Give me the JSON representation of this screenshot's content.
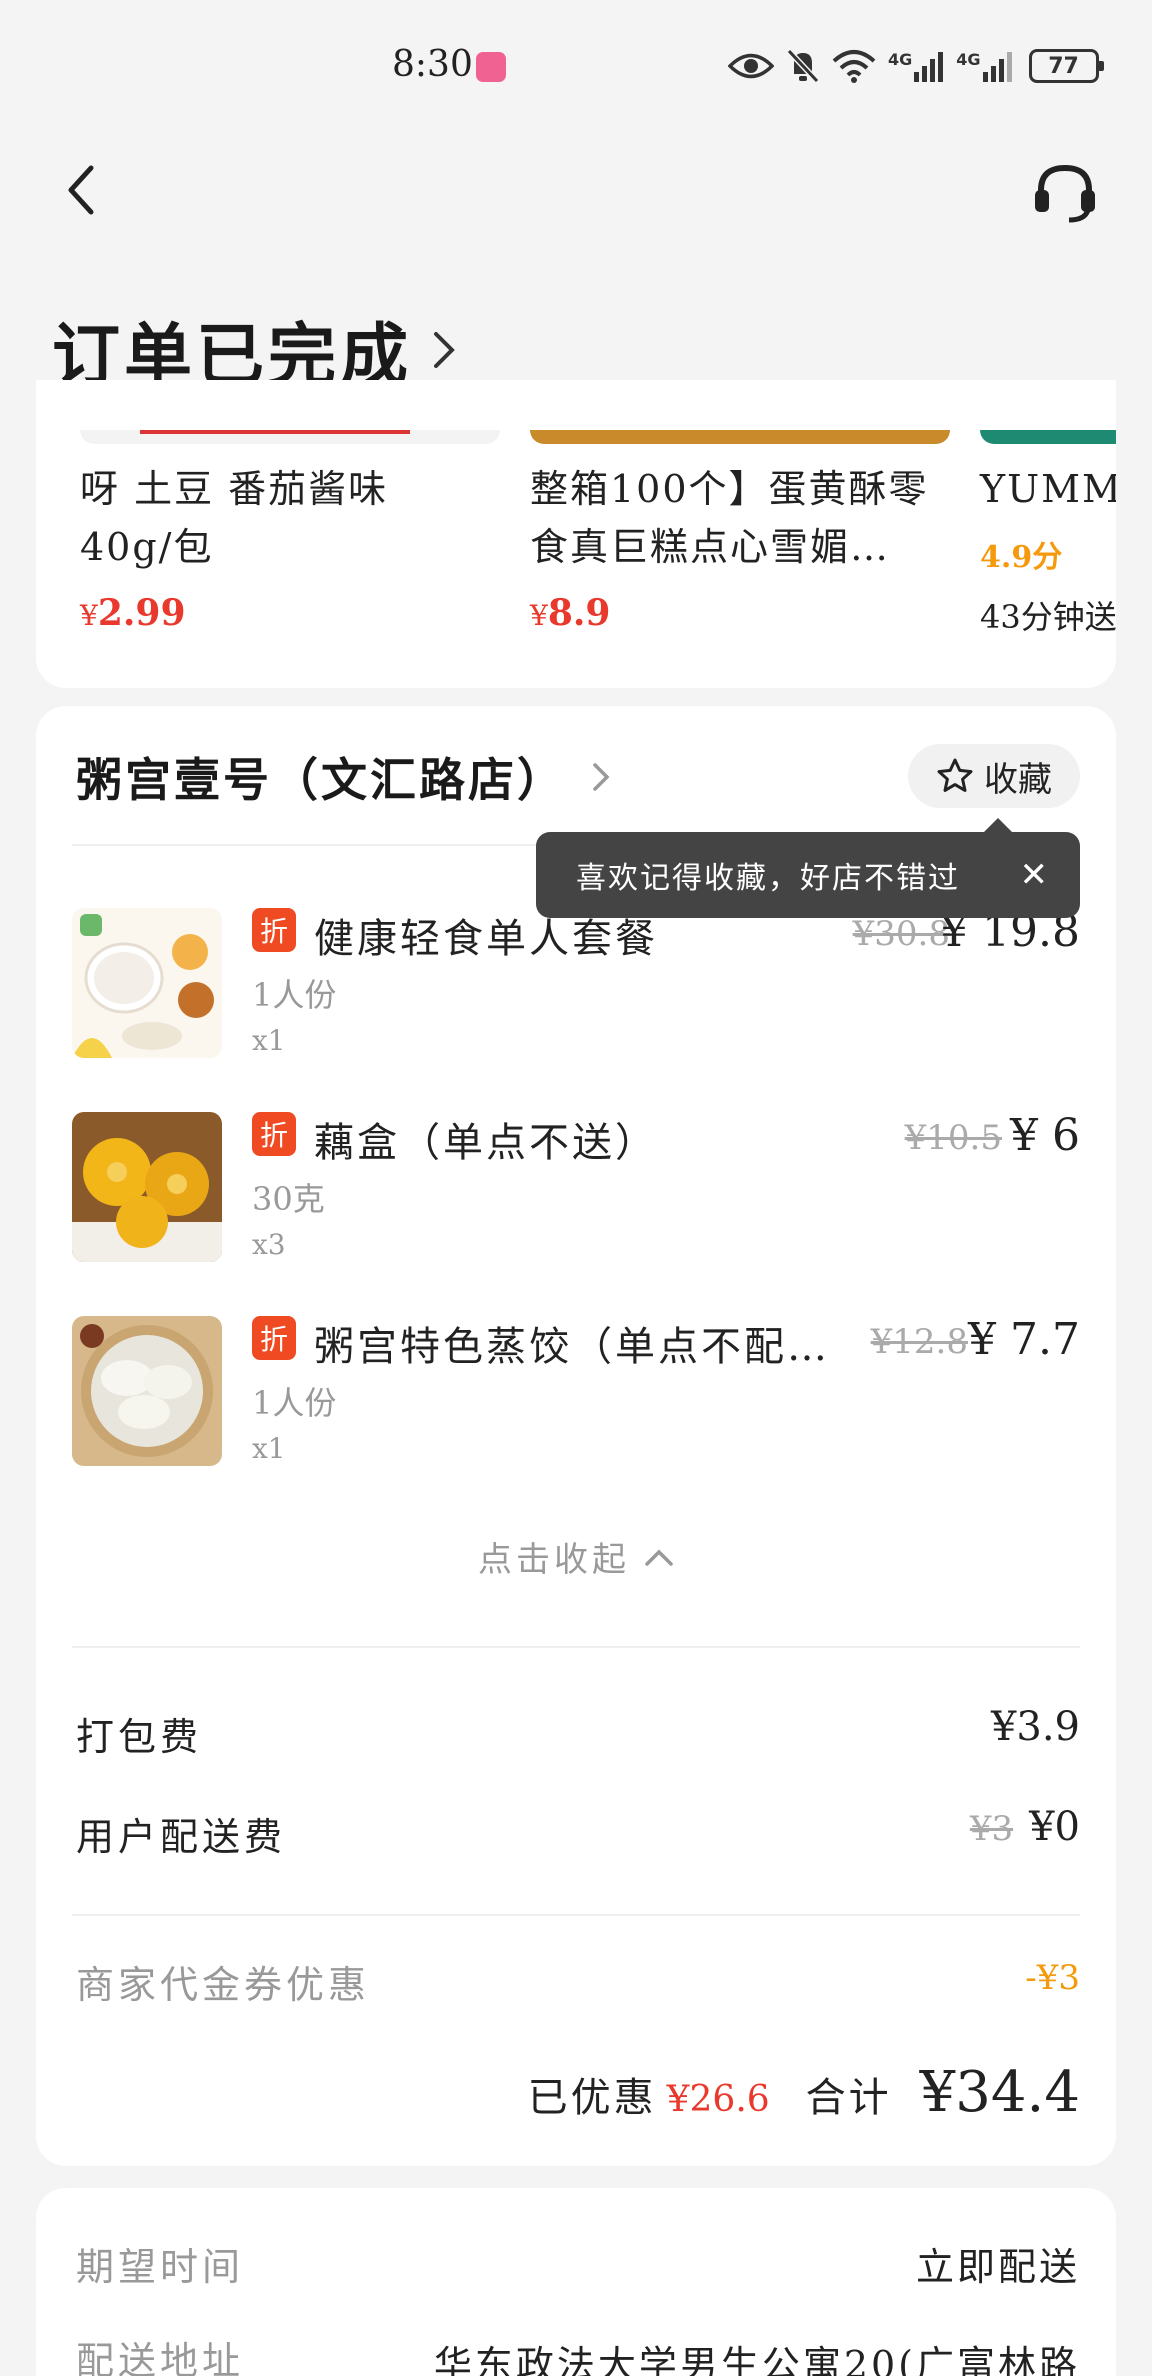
{
  "status_bar": {
    "time": "8:30",
    "battery": "77",
    "signal_1": "4G",
    "signal_2": "4G"
  },
  "header": {
    "title": "订单已完成"
  },
  "recommendations": [
    {
      "name_line1": "呀 土豆 番茄酱味",
      "name_line2": "40g/包",
      "currency": "¥",
      "price": "2.99"
    },
    {
      "name_line1": "整箱100个】蛋黄酥零",
      "name_line2": "食真巨糕点心雪媚…",
      "currency": "¥",
      "price": "8.9"
    },
    {
      "name_line1": "YUMMY韩",
      "rating": "4.9分",
      "delivery": "43分钟送"
    }
  ],
  "store": {
    "name": "粥宫壹号（文汇路店）",
    "favorite_label": "收藏",
    "tooltip": "喜欢记得收藏，好店不错过",
    "tooltip_close": "✕"
  },
  "items": [
    {
      "tag": "折",
      "name": "健康轻食单人套餐",
      "spec": "1人份",
      "qty": "x1",
      "original_price": "¥30.8",
      "price": "¥ 19.8"
    },
    {
      "tag": "折",
      "name": "藕盒（单点不送）",
      "spec": "30克",
      "qty": "x3",
      "original_price": "¥10.5",
      "price": "¥ 6"
    },
    {
      "tag": "折",
      "name": "粥宫特色蒸饺（单点不配…",
      "spec": "1人份",
      "qty": "x1",
      "original_price": "¥12.8",
      "price": "¥ 7.7"
    }
  ],
  "collapse_label": "点击收起",
  "fees": {
    "packing_label": "打包费",
    "packing_value": "¥3.9",
    "delivery_label": "用户配送费",
    "delivery_original": "¥3",
    "delivery_value": "¥0",
    "coupon_label": "商家代金券优惠",
    "coupon_value": "-¥3"
  },
  "totals": {
    "saved_label": "已优惠",
    "saved_value": "¥26.6",
    "total_label": "合计",
    "total_value": "¥34.4"
  },
  "delivery_info": {
    "expected_time_label": "期望时间",
    "expected_time_value": "立即配送",
    "address_label": "配送地址",
    "address_value": "华东政法大学男生公寓20(广富林路"
  },
  "colors": {
    "price_red": "#e8392c",
    "discount_tag": "#f04a23",
    "rating_orange": "#f59a0c",
    "background": "#f4f4f4"
  }
}
